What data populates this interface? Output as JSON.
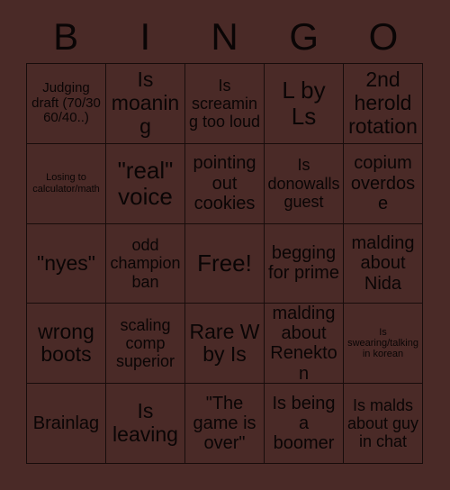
{
  "header": {
    "letters": [
      "B",
      "I",
      "N",
      "G",
      "O"
    ]
  },
  "colors": {
    "background": "#4a2a27",
    "border": "#170c0b",
    "text": "#0a0505"
  },
  "grid": {
    "rows": 5,
    "columns": 5,
    "cells": [
      {
        "text": "Judging draft (70/30 60/40..)",
        "size": "fs-s"
      },
      {
        "text": "Is moaning",
        "size": "fs-xl"
      },
      {
        "text": "Is screaming too loud",
        "size": "fs-m"
      },
      {
        "text": "L by Ls",
        "size": "fs-xxl"
      },
      {
        "text": "2nd herold rotation",
        "size": "fs-xl"
      },
      {
        "text": "Losing to calculator/math",
        "size": "fs-xs"
      },
      {
        "text": "\"real\" voice",
        "size": "fs-xxl"
      },
      {
        "text": "pointing out cookies",
        "size": "fs-l"
      },
      {
        "text": "Is donowalls guest",
        "size": "fs-m"
      },
      {
        "text": "copium overdose",
        "size": "fs-l"
      },
      {
        "text": "\"nyes\"",
        "size": "fs-xl"
      },
      {
        "text": "odd champion ban",
        "size": "fs-m"
      },
      {
        "text": "Free!",
        "size": "fs-xxl"
      },
      {
        "text": "begging for prime",
        "size": "fs-l"
      },
      {
        "text": "malding about Nida",
        "size": "fs-l"
      },
      {
        "text": "wrong boots",
        "size": "fs-xl"
      },
      {
        "text": "scaling comp superior",
        "size": "fs-m"
      },
      {
        "text": "Rare W by Is",
        "size": "fs-xl"
      },
      {
        "text": "malding about Renekton",
        "size": "fs-l"
      },
      {
        "text": "Is swearing/talking in korean",
        "size": "fs-xs"
      },
      {
        "text": "Brainlag",
        "size": "fs-l"
      },
      {
        "text": "Is leaving",
        "size": "fs-xl"
      },
      {
        "text": "\"The game is over\"",
        "size": "fs-l"
      },
      {
        "text": "Is being a boomer",
        "size": "fs-l"
      },
      {
        "text": "Is malds about guy in chat",
        "size": "fs-m"
      }
    ]
  }
}
